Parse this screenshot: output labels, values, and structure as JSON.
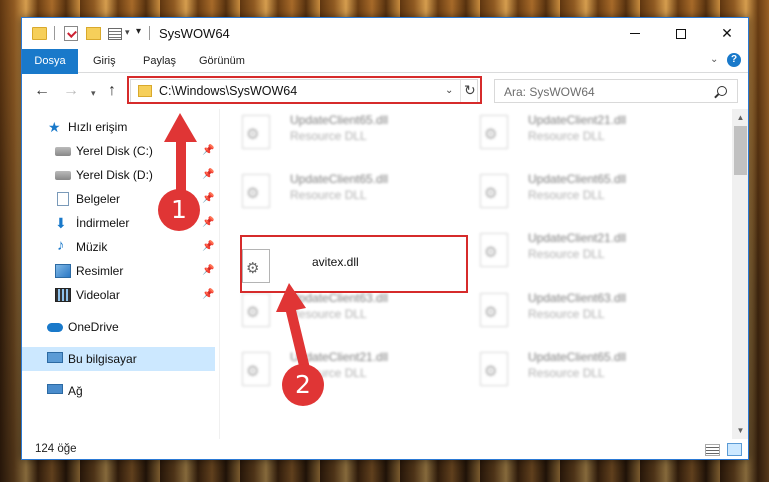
{
  "window": {
    "title": "SysWOW64",
    "controls": {
      "minimize": "–",
      "maximize": "□",
      "close": "✕"
    }
  },
  "quick_access_toolbar": {
    "icons": [
      "folder-icon",
      "properties-icon",
      "new-folder-icon",
      "view-icon",
      "chevron-down-icon"
    ]
  },
  "ribbon": {
    "file_tab": "Dosya",
    "tabs": [
      "Giriş",
      "Paylaş",
      "Görünüm"
    ],
    "help": "?"
  },
  "navigation": {
    "address": "C:\\Windows\\SysWOW64",
    "search_placeholder": "Ara: SysWOW64"
  },
  "sidebar": {
    "items": [
      {
        "label": "Hızlı erişim",
        "icon": "star-icon",
        "pinned": false
      },
      {
        "label": "Yerel Disk (C:)",
        "icon": "disk-icon",
        "pinned": true
      },
      {
        "label": "Yerel Disk (D:)",
        "icon": "disk-icon",
        "pinned": true
      },
      {
        "label": "Belgeler",
        "icon": "documents-icon",
        "pinned": true
      },
      {
        "label": "İndirmeler",
        "icon": "download-icon",
        "pinned": true
      },
      {
        "label": "Müzik",
        "icon": "music-icon",
        "pinned": true
      },
      {
        "label": "Resimler",
        "icon": "pictures-icon",
        "pinned": true
      },
      {
        "label": "Videolar",
        "icon": "videos-icon",
        "pinned": true
      },
      {
        "label": "OneDrive",
        "icon": "onedrive-icon",
        "pinned": false
      },
      {
        "label": "Bu bilgisayar",
        "icon": "computer-icon",
        "pinned": false,
        "selected": true
      },
      {
        "label": "Ağ",
        "icon": "network-icon",
        "pinned": false
      }
    ]
  },
  "files": [
    {
      "name": "UpdateClient65.dll",
      "type": "Resource DLL",
      "blurred": true
    },
    {
      "name": "UpdateClient21.dll",
      "type": "Resource DLL",
      "blurred": true
    },
    {
      "name": "UpdateClient65.dll",
      "type": "Resource DLL",
      "blurred": true
    },
    {
      "name": "UpdateClient65.dll",
      "type": "Resource DLL",
      "blurred": true
    },
    {
      "name": "avitex.dll",
      "type": "",
      "blurred": false
    },
    {
      "name": "UpdateClient21.dll",
      "type": "Resource DLL",
      "blurred": true
    },
    {
      "name": "UpdateClient63.dll",
      "type": "Resource DLL",
      "blurred": true
    },
    {
      "name": "UpdateClient63.dll",
      "type": "Resource DLL",
      "blurred": true
    },
    {
      "name": "UpdateClient21.dll",
      "type": "Resource DLL",
      "blurred": true
    },
    {
      "name": "UpdateClient65.dll",
      "type": "Resource DLL",
      "blurred": true
    }
  ],
  "status": {
    "item_count": "124 öğe"
  },
  "annotations": {
    "step1": "1",
    "step2": "2",
    "color": "#e03535"
  }
}
